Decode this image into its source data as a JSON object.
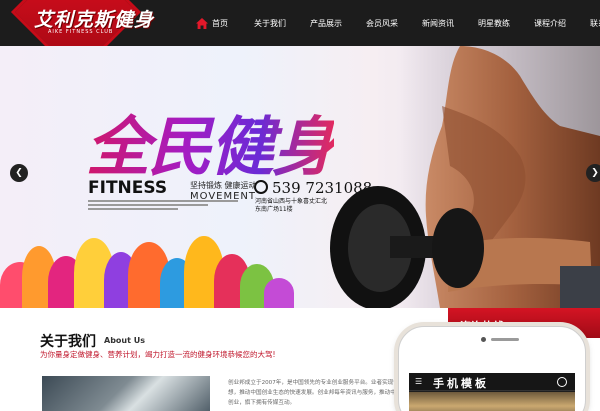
{
  "logo": {
    "text": "艾利克斯健身",
    "subtext": "AIKE FITNESS CLUB"
  },
  "nav": {
    "items": [
      {
        "label": "首页",
        "icon": "home-icon"
      },
      {
        "label": "关于我们"
      },
      {
        "label": "产品展示"
      },
      {
        "label": "会员风采"
      },
      {
        "label": "新闻资讯"
      },
      {
        "label": "明星教练"
      },
      {
        "label": "课程介绍"
      },
      {
        "label": "联系我们"
      }
    ]
  },
  "banner": {
    "title": "全民健身",
    "fitness": "FITNESS",
    "slogan": "坚持锻炼 健康运动",
    "movement": "MOVEMENT",
    "phone": "539 7231088",
    "address_line1": "河南省山西与十象喜丈汇北",
    "address_line2": "东南广场11楼",
    "prev_icon": "chevron-left-icon",
    "next_icon": "chevron-right-icon"
  },
  "about": {
    "title": "关于我们",
    "title_en": "About Us",
    "subtitle": "为你量身定做健身、营养计划，竭力打造一流的健身环境恭候您的大驾!",
    "text": "创业邦成立于2007年，是中国领先的专业创业服务平台。业者实现创业梦想，推动中国创业生态的快速发展。创业邦每年资讯与服务，推动中国创新创业，旗下拥有传媒互动。"
  },
  "consult": {
    "label": "资询热线："
  },
  "mockup": {
    "title": "手机模板",
    "menu_icon": "menu-icon",
    "user_icon": "user-icon"
  },
  "colors": {
    "brand_red": "#d41423",
    "header_bg": "#1c1c1c"
  }
}
